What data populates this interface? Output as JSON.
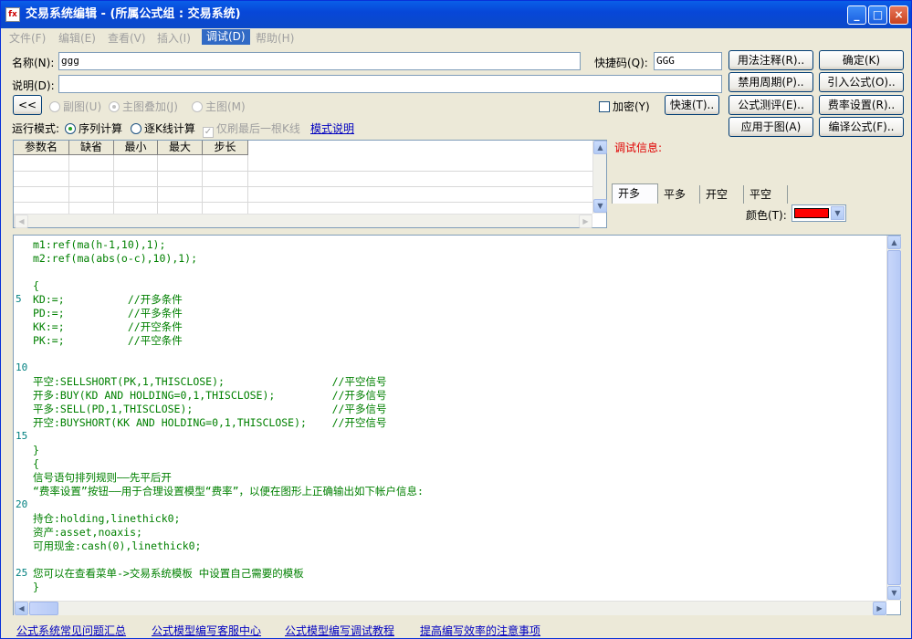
{
  "window": {
    "title": "交易系统编辑 - (所属公式组 : 交易系统)",
    "icon": "editor-app-icon",
    "min": "_",
    "max": "□",
    "close": "×"
  },
  "menu": [
    {
      "label": "文件(F)",
      "active": false
    },
    {
      "label": "编辑(E)",
      "active": false
    },
    {
      "label": "查看(V)",
      "active": false
    },
    {
      "label": "插入(I)",
      "active": false
    },
    {
      "label": "调试(D)",
      "active": true
    },
    {
      "label": "帮助(H)",
      "active": false
    }
  ],
  "form": {
    "name_label": "名称(N):",
    "name_value": "ggg",
    "shortcut_label": "快捷码(Q):",
    "shortcut_value": "GGG",
    "desc_label": "说明(D):",
    "desc_value": "",
    "collapse": "<<",
    "sub_chart": "副图(U)",
    "main_overlay": "主图叠加(J)",
    "main_chart": "主图(M)",
    "encrypt_label": "加密(Y)",
    "quick_btn": "快速(T)..",
    "run_mode_label": "运行模式:",
    "seq_calc": "序列计算",
    "bar_calc": "逐K线计算",
    "last_bar": "仅刷最后一根K线",
    "mode_help": "模式说明"
  },
  "buttons": {
    "usage": "用法注释(R)..",
    "ok": "确定(K)",
    "disable_period": "禁用周期(P)..",
    "import": "引入公式(O)..",
    "evaluate": "公式测评(E)..",
    "fee": "费率设置(R)..",
    "apply": "应用于图(A)",
    "compile": "编译公式(F).."
  },
  "params": {
    "headers": [
      "参数名",
      "缺省",
      "最小",
      "最大",
      "步长"
    ]
  },
  "debug": {
    "label": "调试信息:"
  },
  "signal_tabs": [
    "开多",
    "平多",
    "开空",
    "平空"
  ],
  "color": {
    "label": "颜色(T):",
    "value": "#FF0000"
  },
  "code": {
    "line_numbers": [
      "5",
      "10",
      "15",
      "20",
      "25"
    ],
    "lines": [
      "m1:ref(ma(h-1,10),1);",
      "m2:ref(ma(abs(o-c),10),1);",
      "",
      "{",
      "KD:=;          //开多条件",
      "PD:=;          //平多条件",
      "KK:=;          //开空条件",
      "PK:=;          //平空条件",
      "",
      "",
      "平空:SELLSHORT(PK,1,THISCLOSE);                 //平空信号",
      "开多:BUY(KD AND HOLDING=0,1,THISCLOSE);         //开多信号",
      "平多:SELL(PD,1,THISCLOSE);                      //平多信号",
      "开空:BUYSHORT(KK AND HOLDING=0,1,THISCLOSE);    //开空信号",
      "",
      "}",
      "{",
      "信号语句排列规则——先平后开",
      "“费率设置”按钮——用于合理设置模型“费率”，以便在图形上正确输出如下帐户信息:",
      "",
      "持仓:holding,linethick0;",
      "资产:asset,noaxis;",
      "可用现金:cash(0),linethick0;",
      "",
      "您可以在查看菜单->交易系统模板 中设置自己需要的模板",
      "}"
    ]
  },
  "footer_links": [
    "公式系统常见问题汇总",
    "公式模型编写客服中心",
    "公式模型编写调试教程",
    "提高编写效率的注意事项"
  ]
}
